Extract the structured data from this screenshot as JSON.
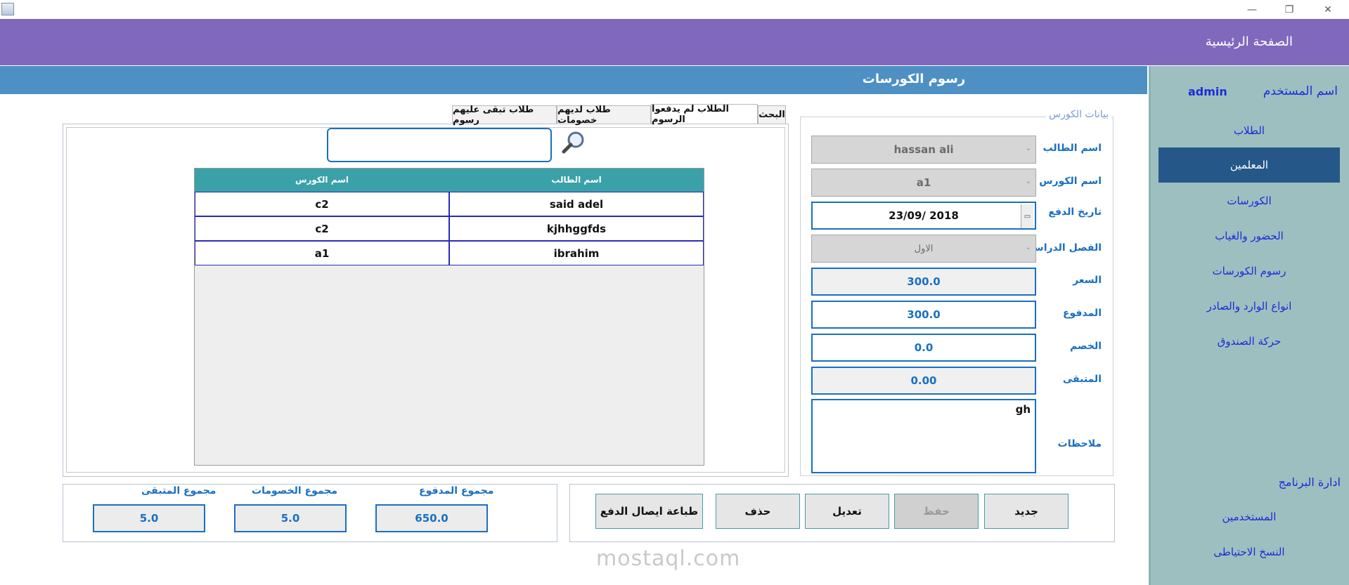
{
  "window": {
    "minimize": "—",
    "restore": "❐",
    "close": "✕"
  },
  "header": {
    "title": "الصفحة الرئيسية"
  },
  "section": {
    "title": "رسوم الكورسات"
  },
  "sidebar": {
    "user_label": "اسم المستخدم",
    "user_value": "admin",
    "items": [
      {
        "label": "الطلاب"
      },
      {
        "label": "المعلمين"
      },
      {
        "label": "الكورسات"
      },
      {
        "label": "الحضور والغياب"
      },
      {
        "label": "رسوم الكورسات"
      },
      {
        "label": "انواع الوارد والصادر"
      },
      {
        "label": "حركة الصندوق"
      }
    ],
    "admin_section": "ادارة البرنامج",
    "admin_items": [
      {
        "label": "المستخدمين"
      },
      {
        "label": "النسخ الاحتياطى"
      }
    ]
  },
  "course_form": {
    "legend": "بيانات الكورس",
    "student_label": "اسم الطالب",
    "student_value": "hassan ali",
    "course_label": "اسم الكورس",
    "course_value": "a1",
    "date_label": "تاريخ الدفع",
    "date_value": "23/09/ 2018",
    "semester_label": "الفصل الدراسى",
    "semester_value": "الاول",
    "price_label": "السعر",
    "price_value": "300.0",
    "paid_label": "المدفوع",
    "paid_value": "300.0",
    "discount_label": "الخصم",
    "discount_value": "0.0",
    "remaining_label": "المتبقى",
    "remaining_value": "0.00",
    "notes_label": "ملاحظات",
    "notes_value": "gh"
  },
  "tabs": [
    {
      "label": "البحث"
    },
    {
      "label": "الطلاب لم يدفعوا الرسوم"
    },
    {
      "label": "طلاب لديهم خصومات"
    },
    {
      "label": "طلاب تبقى عليهم رسوم"
    }
  ],
  "search": {
    "placeholder": ""
  },
  "table": {
    "columns": [
      "اسم الطالب",
      "اسم الكورس"
    ],
    "rows": [
      [
        "said adel",
        "c2"
      ],
      [
        "kjhhggfds",
        "c2"
      ],
      [
        "ibrahim",
        "a1"
      ]
    ]
  },
  "totals": {
    "paid_label": "مجموع المدفوع",
    "paid_value": "650.0",
    "discounts_label": "مجموع  الخصومات",
    "discounts_value": "5.0",
    "remaining_label": "مجموع المتبقى",
    "remaining_value": "5.0"
  },
  "actions": {
    "new": "جديد",
    "save": "حفظ",
    "edit": "تعديل",
    "delete": "حذف",
    "print": "طباعة ايصال الدفع"
  },
  "watermark": {
    "text": "mostaql.com"
  }
}
